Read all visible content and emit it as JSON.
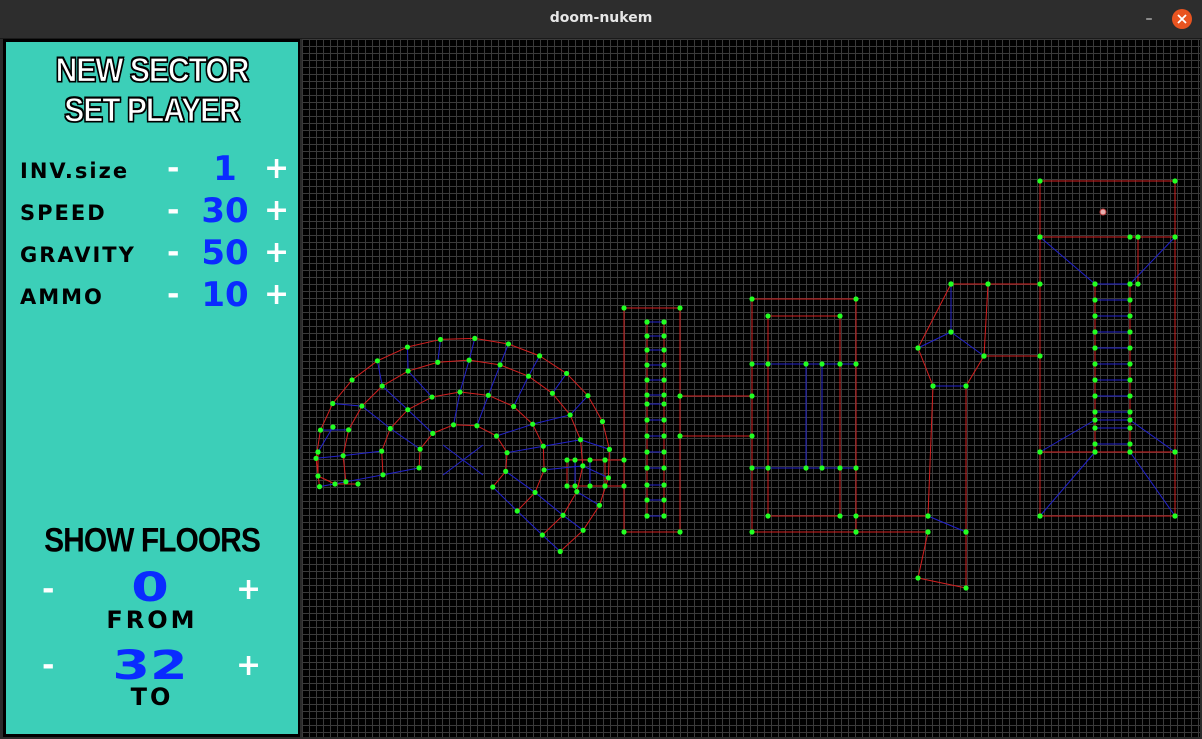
{
  "window": {
    "title": "doom-nukem"
  },
  "panel": {
    "menu": {
      "new_sector": "NEW SECTOR",
      "set_player": "SET PLAYER"
    },
    "params": [
      {
        "label": "INV.size",
        "minus": "-",
        "value": "1",
        "plus": "+"
      },
      {
        "label": "SPEED",
        "minus": "-",
        "value": "30",
        "plus": "+"
      },
      {
        "label": "GRAVITY",
        "minus": "-",
        "value": "50",
        "plus": "+"
      },
      {
        "label": "AMMO",
        "minus": "-",
        "value": "10",
        "plus": "+"
      }
    ],
    "floors": {
      "title": "SHOW FLOORS",
      "from": {
        "minus": "-",
        "value": "0",
        "plus": "+",
        "label": "FROM"
      },
      "to": {
        "minus": "-",
        "value": "32",
        "plus": "+",
        "label": "TO"
      }
    }
  },
  "editor": {
    "colors": {
      "background": "#000000",
      "grid": "#3a3a3a",
      "wall": "#d42020",
      "portal": "#2222cc",
      "vertex": "#22ff22",
      "player": "#e8b0b0"
    }
  }
}
